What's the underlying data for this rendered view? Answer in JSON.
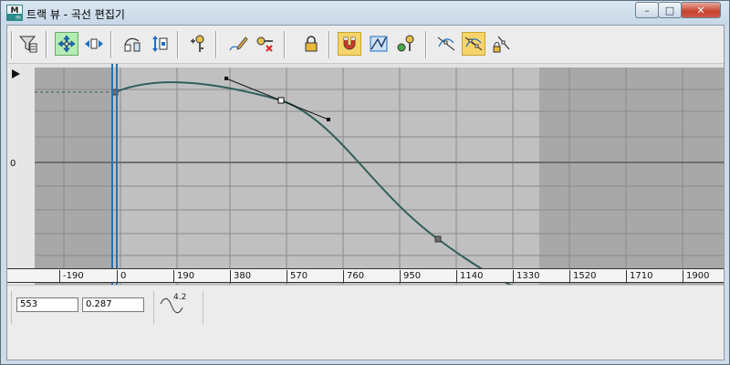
{
  "window": {
    "title": "트랙 뷰 - 곡선 편집기",
    "app_icon": "max-app-icon",
    "controls": {
      "minimize": "–",
      "maximize": "□",
      "close": "✕"
    }
  },
  "toolbar": {
    "buttons": [
      {
        "name": "filters-button",
        "icon": "filter-icon",
        "active": false
      },
      {
        "name": "move-keys-button",
        "icon": "move-keys-icon",
        "active": true,
        "accent": "#b4ecb4"
      },
      {
        "name": "slide-keys-button",
        "icon": "slide-keys-icon",
        "active": false
      },
      {
        "name": "scale-keys-button",
        "icon": "scale-keys-icon",
        "active": false
      },
      {
        "name": "scale-values-button",
        "icon": "scale-values-icon",
        "active": false
      },
      {
        "name": "add-keys-button",
        "icon": "add-key-icon",
        "active": false
      },
      {
        "name": "draw-curves-button",
        "icon": "pencil-curve-icon",
        "active": false
      },
      {
        "name": "reduce-keys-button",
        "icon": "reduce-keys-icon",
        "active": false
      },
      {
        "name": "lock-selection-button",
        "icon": "lock-icon",
        "active": false
      },
      {
        "name": "snap-frames-button",
        "icon": "magnet-icon",
        "active": true,
        "accent": "#f6d46a"
      },
      {
        "name": "parameter-curve-oor-button",
        "icon": "curve-range-icon",
        "active": false
      },
      {
        "name": "show-keyable-icons-button",
        "icon": "keyable-icon",
        "active": false
      },
      {
        "name": "show-tangents-button",
        "icon": "tangents-icon",
        "active": false
      },
      {
        "name": "show-all-tangents-button",
        "icon": "all-tangents-icon",
        "active": true,
        "accent": "#f6d46a"
      },
      {
        "name": "lock-tangents-button",
        "icon": "lock-tangent-icon",
        "active": false
      }
    ]
  },
  "graph": {
    "zero_label": "0",
    "curve_color": "#2f5f5a",
    "background_active": "#c0c0c0",
    "background_inactive": "#a8a8a8",
    "time_slider_color": "#2a6fb0"
  },
  "ruler": {
    "ticks": [
      "-190",
      "0",
      "190",
      "380",
      "570",
      "760",
      "950",
      "1140",
      "1330",
      "1520",
      "1710",
      "1900"
    ]
  },
  "status": {
    "frame_value": "553",
    "key_value": "0.287",
    "curve_indicator_label": "4.2"
  }
}
